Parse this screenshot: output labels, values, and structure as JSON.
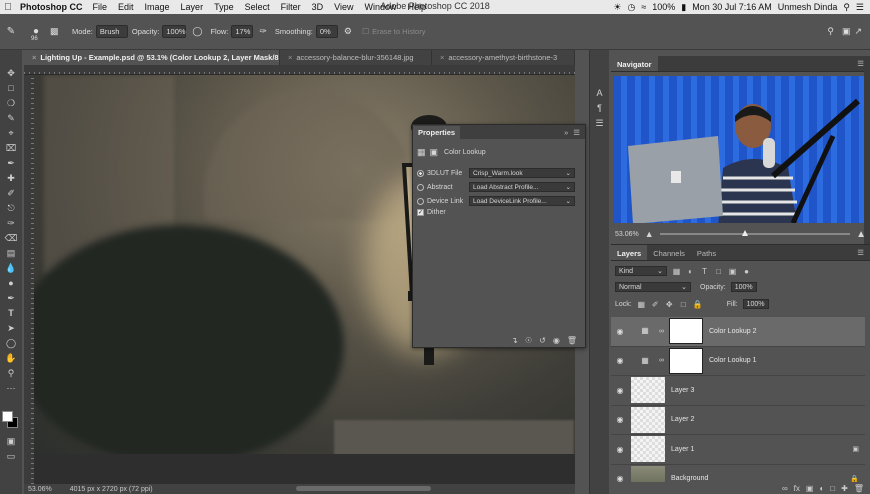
{
  "menubar": {
    "apple": "",
    "app_name": "Photoshop CC",
    "items": [
      "File",
      "Edit",
      "Image",
      "Layer",
      "Type",
      "Select",
      "Filter",
      "3D",
      "View",
      "Window",
      "Help"
    ],
    "window_title": "Adobe Photoshop CC 2018",
    "battery": "100%",
    "datetime": "Mon 30 Jul  7:16 AM",
    "user": "Unmesh Dinda"
  },
  "options": {
    "brush_size": "96",
    "mode_label": "Mode:",
    "mode_value": "Brush",
    "opacity_label": "Opacity:",
    "opacity_value": "100%",
    "flow_label": "Flow:",
    "flow_value": "17%",
    "smoothing_label": "Smoothing:",
    "smoothing_value": "0%",
    "erase_history": "Erase to History"
  },
  "tabs": [
    {
      "label": "Lighting Up - Example.psd @ 53.1% (Color Lookup 2, Layer Mask/8) *",
      "active": true
    },
    {
      "label": "accessory-balance-blur-356148.jpg",
      "active": false
    },
    {
      "label": "accessory-amethyst-birthstone-3",
      "active": false
    }
  ],
  "status": {
    "zoom": "53.06%",
    "doc_info": "4015 px x 2720 px (72 ppi)"
  },
  "properties": {
    "title": "Properties",
    "adjustment": "Color Lookup",
    "rows": [
      {
        "label": "3DLUT File",
        "value": "Crisp_Warm.look",
        "checked": true
      },
      {
        "label": "Abstract",
        "value": "Load Abstract Profile...",
        "checked": false
      },
      {
        "label": "Device Link",
        "value": "Load DeviceLink Profile...",
        "checked": false
      }
    ],
    "dither": "Dither"
  },
  "navigator": {
    "title": "Navigator",
    "zoom": "53.06%",
    "zoom_fraction": 0.45
  },
  "layers_panel": {
    "tabs": [
      "Layers",
      "Channels",
      "Paths"
    ],
    "filter_kind": "Kind",
    "blend_mode": "Normal",
    "opacity_label": "Opacity:",
    "opacity_value": "100%",
    "lock_label": "Lock:",
    "fill_label": "Fill:",
    "fill_value": "100%",
    "layers": [
      {
        "name": "Color Lookup 2",
        "type": "adjustment",
        "selected": true
      },
      {
        "name": "Color Lookup 1",
        "type": "adjustment",
        "selected": false
      },
      {
        "name": "Layer 3",
        "type": "pixel",
        "selected": false
      },
      {
        "name": "Layer 2",
        "type": "pixel",
        "selected": false
      },
      {
        "name": "Layer 1",
        "type": "pixel",
        "selected": false
      },
      {
        "name": "Background",
        "type": "photo",
        "selected": false
      }
    ]
  }
}
